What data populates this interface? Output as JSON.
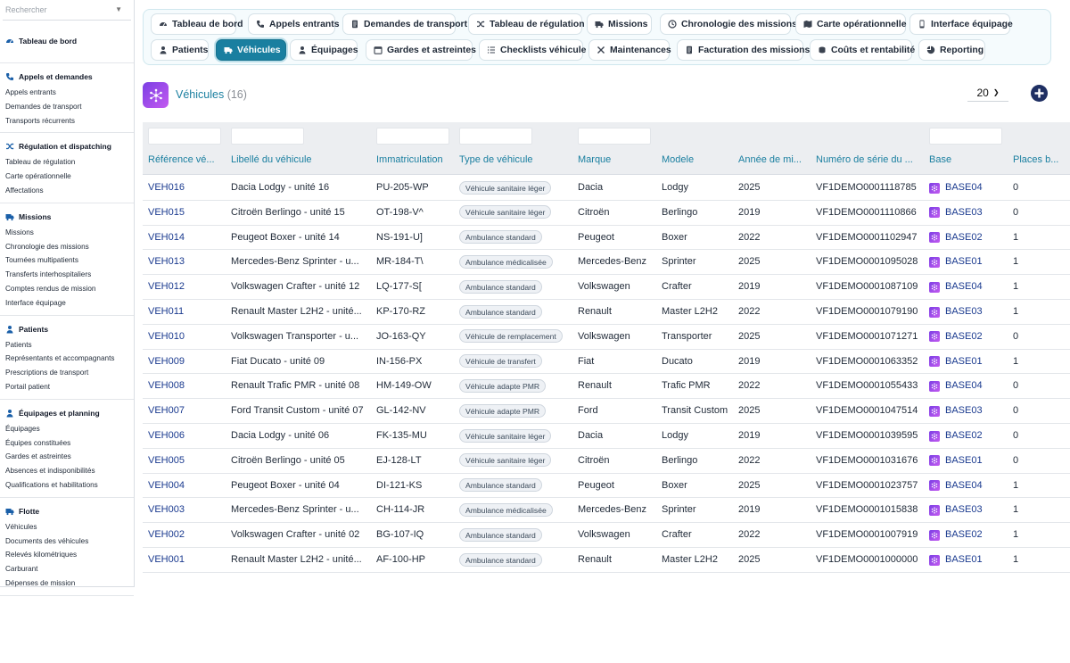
{
  "search": {
    "placeholder": "Rechercher"
  },
  "sidebar": {
    "sections": [
      {
        "title": "Tableau de bord",
        "icon": "dashboard-icon",
        "items": []
      },
      {
        "title": "Appels et demandes",
        "icon": "phone-icon",
        "items": [
          "Appels entrants",
          "Demandes de transport",
          "Transports récurrents"
        ]
      },
      {
        "title": "Régulation et dispatching",
        "icon": "shuffle-icon",
        "items": [
          "Tableau de régulation",
          "Carte opérationnelle",
          "Affectations"
        ]
      },
      {
        "title": "Missions",
        "icon": "truck-icon",
        "items": [
          "Missions",
          "Chronologie des missions",
          "Tournées multipatients",
          "Transferts interhospitaliers",
          "Comptes rendus de mission",
          "Interface équipage"
        ]
      },
      {
        "title": "Patients",
        "icon": "person-icon",
        "items": [
          "Patients",
          "Représentants et accompagnants",
          "Prescriptions de transport",
          "Portail patient"
        ]
      },
      {
        "title": "Équipages et planning",
        "icon": "person-icon",
        "items": [
          "Équipages",
          "Équipes constituées",
          "Gardes et astreintes",
          "Absences et indisponibilités",
          "Qualifications et habilitations"
        ]
      },
      {
        "title": "Flotte",
        "icon": "truck-icon",
        "items": [
          "Véhicules",
          "Documents des véhicules",
          "Relevés kilométriques",
          "Carburant",
          "Dépenses de mission"
        ]
      }
    ]
  },
  "nav": {
    "tabs": [
      {
        "label": "Tableau de bord",
        "icon": "dashboard-icon"
      },
      {
        "label": "Appels entrants",
        "icon": "phone-icon"
      },
      {
        "label": "Demandes de transport",
        "icon": "document-icon"
      },
      {
        "label": "Tableau de régulation",
        "icon": "shuffle-icon"
      },
      {
        "label": "Missions",
        "icon": "truck-icon"
      },
      {
        "label": "Chronologie des missions",
        "icon": "clock-icon"
      },
      {
        "label": "Carte opérationnelle",
        "icon": "map-icon"
      },
      {
        "label": "Interface équipage",
        "icon": "phone-device-icon"
      },
      {
        "label": "Patients",
        "icon": "person-icon"
      },
      {
        "label": "Véhicules",
        "icon": "truck-icon",
        "active": true
      },
      {
        "label": "Équipages",
        "icon": "person-icon"
      },
      {
        "label": "Gardes et astreintes",
        "icon": "calendar-icon"
      },
      {
        "label": "Checklists véhicule",
        "icon": "checklist-icon"
      },
      {
        "label": "Maintenances",
        "icon": "wrench-icon"
      },
      {
        "label": "Facturation des missions",
        "icon": "document-icon"
      },
      {
        "label": "Coûts et rentabilité",
        "icon": "coins-icon"
      },
      {
        "label": "Reporting",
        "icon": "chart-icon"
      }
    ]
  },
  "header": {
    "title": "Véhicules",
    "count": "(16)",
    "page_size": "20"
  },
  "colors": {
    "accent": "#1a7fa0",
    "link": "#1a3a8f",
    "add_button": "#1f2f63",
    "base_icon": "#7b3fe4"
  },
  "table": {
    "columns": [
      "Référence vé...",
      "Libellé du véhicule",
      "Immatriculation",
      "Type de véhicule",
      "Marque",
      "Modele",
      "Année de mi...",
      "Numéro de série du ...",
      "Base",
      "Places b..."
    ],
    "rows": [
      [
        "VEH016",
        "Dacia Lodgy - unité 16",
        "PU-205-WP",
        "Véhicule sanitaire léger",
        "Dacia",
        "Lodgy",
        "2025",
        "VF1DEMO0001118785",
        "BASE04",
        "0"
      ],
      [
        "VEH015",
        "Citroën Berlingo - unité 15",
        "OT-198-V^",
        "Véhicule sanitaire léger",
        "Citroën",
        "Berlingo",
        "2019",
        "VF1DEMO0001110866",
        "BASE03",
        "0"
      ],
      [
        "VEH014",
        "Peugeot Boxer - unité 14",
        "NS-191-U]",
        "Ambulance standard",
        "Peugeot",
        "Boxer",
        "2022",
        "VF1DEMO0001102947",
        "BASE02",
        "1"
      ],
      [
        "VEH013",
        "Mercedes-Benz Sprinter - u...",
        "MR-184-T\\",
        "Ambulance médicalisée",
        "Mercedes-Benz",
        "Sprinter",
        "2025",
        "VF1DEMO0001095028",
        "BASE01",
        "1"
      ],
      [
        "VEH012",
        "Volkswagen Crafter - unité 12",
        "LQ-177-S[",
        "Ambulance standard",
        "Volkswagen",
        "Crafter",
        "2019",
        "VF1DEMO0001087109",
        "BASE04",
        "1"
      ],
      [
        "VEH011",
        "Renault Master L2H2 - unité...",
        "KP-170-RZ",
        "Ambulance standard",
        "Renault",
        "Master L2H2",
        "2022",
        "VF1DEMO0001079190",
        "BASE03",
        "1"
      ],
      [
        "VEH010",
        "Volkswagen Transporter - u...",
        "JO-163-QY",
        "Véhicule de remplacement",
        "Volkswagen",
        "Transporter",
        "2025",
        "VF1DEMO0001071271",
        "BASE02",
        "0"
      ],
      [
        "VEH009",
        "Fiat Ducato - unité 09",
        "IN-156-PX",
        "Véhicule de transfert",
        "Fiat",
        "Ducato",
        "2019",
        "VF1DEMO0001063352",
        "BASE01",
        "1"
      ],
      [
        "VEH008",
        "Renault Trafic PMR - unité 08",
        "HM-149-OW",
        "Véhicule adapte PMR",
        "Renault",
        "Trafic PMR",
        "2022",
        "VF1DEMO0001055433",
        "BASE04",
        "0"
      ],
      [
        "VEH007",
        "Ford Transit Custom - unité 07",
        "GL-142-NV",
        "Véhicule adapte PMR",
        "Ford",
        "Transit Custom",
        "2025",
        "VF1DEMO0001047514",
        "BASE03",
        "0"
      ],
      [
        "VEH006",
        "Dacia Lodgy - unité 06",
        "FK-135-MU",
        "Véhicule sanitaire léger",
        "Dacia",
        "Lodgy",
        "2019",
        "VF1DEMO0001039595",
        "BASE02",
        "0"
      ],
      [
        "VEH005",
        "Citroën Berlingo - unité 05",
        "EJ-128-LT",
        "Véhicule sanitaire léger",
        "Citroën",
        "Berlingo",
        "2022",
        "VF1DEMO0001031676",
        "BASE01",
        "0"
      ],
      [
        "VEH004",
        "Peugeot Boxer - unité 04",
        "DI-121-KS",
        "Ambulance standard",
        "Peugeot",
        "Boxer",
        "2025",
        "VF1DEMO0001023757",
        "BASE04",
        "1"
      ],
      [
        "VEH003",
        "Mercedes-Benz Sprinter - u...",
        "CH-114-JR",
        "Ambulance médicalisée",
        "Mercedes-Benz",
        "Sprinter",
        "2019",
        "VF1DEMO0001015838",
        "BASE03",
        "1"
      ],
      [
        "VEH002",
        "Volkswagen Crafter - unité 02",
        "BG-107-IQ",
        "Ambulance standard",
        "Volkswagen",
        "Crafter",
        "2022",
        "VF1DEMO0001007919",
        "BASE02",
        "1"
      ],
      [
        "VEH001",
        "Renault Master L2H2 - unité...",
        "AF-100-HP",
        "Ambulance standard",
        "Renault",
        "Master L2H2",
        "2025",
        "VF1DEMO0001000000",
        "BASE01",
        "1"
      ]
    ]
  }
}
